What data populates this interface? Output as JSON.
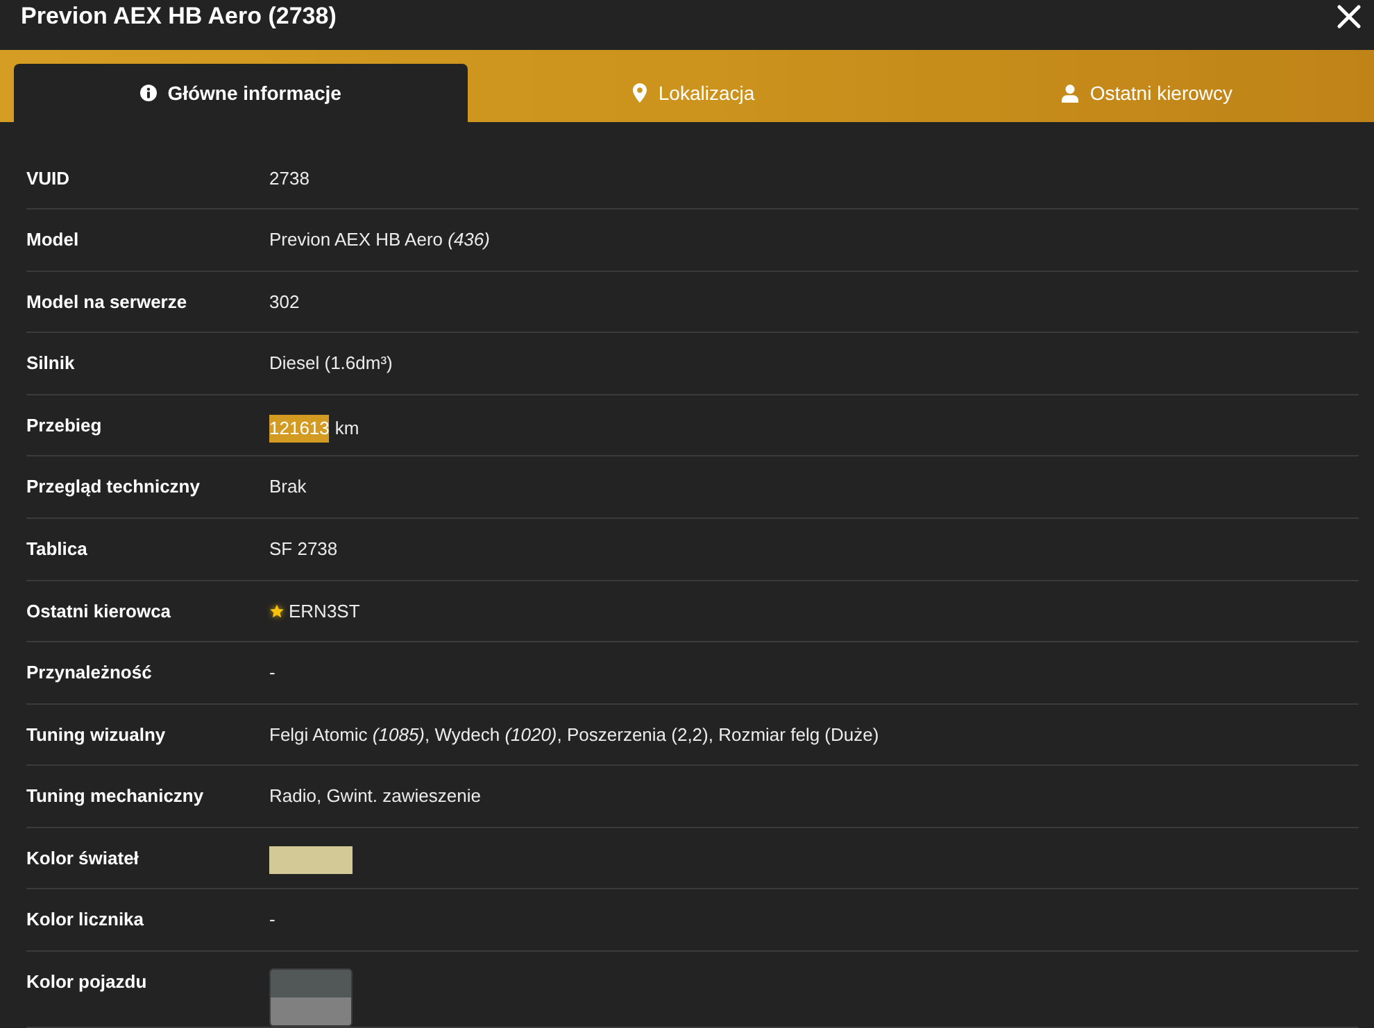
{
  "window": {
    "title": "Previon AEX HB Aero (2738)"
  },
  "tabs": [
    {
      "label": "Główne informacje",
      "selected": true
    },
    {
      "label": "Lokalizacja",
      "selected": false
    },
    {
      "label": "Ostatni kierowcy",
      "selected": false
    }
  ],
  "rows": [
    {
      "label": "VUID",
      "kind": "text",
      "value": "2738"
    },
    {
      "label": "Model",
      "kind": "text",
      "value": "Previon AEX HB Aero *(436)*"
    },
    {
      "label": "Model na serwerze",
      "kind": "text",
      "value": "302"
    },
    {
      "label": "Silnik",
      "kind": "text",
      "value": "Diesel (1.6dm³)"
    },
    {
      "label": "Przebieg",
      "kind": "highlighted",
      "highlight": "121613",
      "value": "km"
    },
    {
      "label": "Przegląd techniczny",
      "kind": "text",
      "value": "Brak"
    },
    {
      "label": "Tablica",
      "kind": "text",
      "value": "SF 2738"
    },
    {
      "label": "Ostatni kierowca",
      "kind": "driver",
      "starred": true,
      "value": "ERN3ST"
    },
    {
      "label": "Przynależność",
      "kind": "text",
      "value": "-"
    },
    {
      "label": "Tuning wizualny",
      "kind": "text",
      "value": "Felgi Atomic *(1085)*, Wydech *(1020)*, Poszerzenia (2,2), Rozmiar felg (Duże)"
    },
    {
      "label": "Tuning mechaniczny",
      "kind": "text",
      "value": "Radio, Gwint. zawieszenie"
    },
    {
      "label": "Kolor świateł",
      "kind": "swatch",
      "color": "#d3c997"
    },
    {
      "label": "Kolor licznika",
      "kind": "text",
      "value": "-"
    },
    {
      "label": "Kolor pojazdu",
      "kind": "split_swatch",
      "segments": [
        {
          "color": "#525857"
        },
        {
          "color": "#808080"
        }
      ]
    }
  ]
}
